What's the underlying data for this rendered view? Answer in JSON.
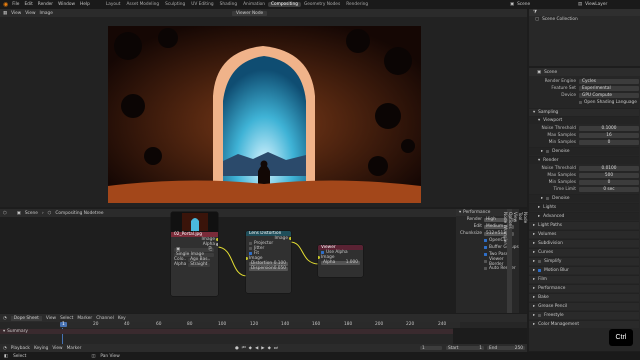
{
  "topbar": {
    "menus": [
      "File",
      "Edit",
      "Render",
      "Window",
      "Help"
    ],
    "workspaces": [
      "Layout",
      "Asset Modeling",
      "Sculpting",
      "UV Editing",
      "Shading",
      "Animation",
      "Compositing",
      "Geometry Nodes",
      "Rendering"
    ],
    "active_workspace": "Compositing",
    "scene": "Scene",
    "view_layer": "ViewLayer"
  },
  "image_header": {
    "menus": [
      "View",
      "View",
      "Image"
    ],
    "title": "Viewer Node"
  },
  "outliner": {
    "root": "Scene Collection"
  },
  "node_header": {
    "scene": "Scene",
    "breadcrumb": "Compositing Nodetree"
  },
  "nodes": {
    "image": {
      "title": "02_Portal.jpg",
      "out_image": "Image",
      "out_alpha": "Alpha",
      "single_image": "Single Image",
      "color_label": "Colo..",
      "color_value": "Agx Bas..",
      "alpha_label": "Alpha",
      "alpha_value": "Straight"
    },
    "lens": {
      "title": "Lens Distortion",
      "out_image": "Image",
      "projector": "Projector",
      "jitter": "Jitter",
      "fit": "Fit",
      "in_image": "Image",
      "distortion_label": "Distortion",
      "distortion_value": "0.100",
      "dispersion_label": "Dispersion",
      "dispersion_value": "0.050"
    },
    "viewer": {
      "title": "Viewer",
      "use_alpha": "Use Alpha",
      "in_image": "Image",
      "alpha_label": "Alpha",
      "alpha_value": "1.000"
    }
  },
  "perf": {
    "title": "Performance",
    "render_label": "Render",
    "render_value": "High",
    "edit_label": "Edit",
    "edit_value": "Medium",
    "chunk_label": "Chunksize",
    "chunk_value": "512×512",
    "opencl": "OpenCL",
    "buffer": "Buffer Groups",
    "twopass": "Two Pass",
    "viewer_border": "Viewer Border",
    "auto_render": "Auto Render"
  },
  "side_tabs": [
    "Node",
    "Tool",
    "View",
    "Options",
    "Node Wrangler"
  ],
  "props": {
    "scene": "Scene",
    "engine_label": "Render Engine",
    "engine_value": "Cycles",
    "feature_label": "Feature Set",
    "feature_value": "Experimental",
    "device_label": "Device",
    "device_value": "GPU Compute",
    "osl": "Open Shading Language",
    "sampling": "Sampling",
    "viewport": "Viewport",
    "noise_label": "Noise Threshold",
    "noise_value": "0.1000",
    "max_label": "Max Samples",
    "max_value": "16",
    "min_label": "Min Samples",
    "min_value": "0",
    "denoise": "Denoise",
    "render": "Render",
    "rnoise_value": "0.0100",
    "rmax_value": "500",
    "rmin_value": "0",
    "time_label": "Time Limit",
    "time_value": "0 sec",
    "rdenoise": "Denoise",
    "lights": "Lights",
    "advanced": "Advanced",
    "light_paths": "Light Paths",
    "volumes": "Volumes",
    "subdivision": "Subdivision",
    "curves": "Curves",
    "simplify": "Simplify",
    "motion_blur": "Motion Blur",
    "film": "Film",
    "performance": "Performance",
    "bake": "Bake",
    "grease": "Grease Pencil",
    "freestyle": "Freestyle",
    "color": "Color Management"
  },
  "timeline": {
    "mode": "Dope Sheet",
    "menus": [
      "View",
      "Select",
      "Marker",
      "Channel",
      "Key"
    ],
    "summary": "Summary",
    "ticks": [
      "0",
      "20",
      "40",
      "60",
      "80",
      "100",
      "120",
      "140",
      "160",
      "180",
      "200",
      "220",
      "240"
    ],
    "current_frame": "1",
    "playback": "Playback",
    "keying": "Keying",
    "view": "View",
    "marker": "Marker",
    "start_label": "Start",
    "start": "1",
    "end_label": "End",
    "end": "250"
  },
  "statusbar": {
    "select": "Select",
    "pan": "Pan View",
    "ctrl": "Ctrl"
  },
  "colors": {
    "accent": "#4772b3",
    "image_node": "#7a2b39",
    "lens_node": "#1f4e5a",
    "viewer_node": "#5a2233",
    "wire": "#e6e033"
  }
}
